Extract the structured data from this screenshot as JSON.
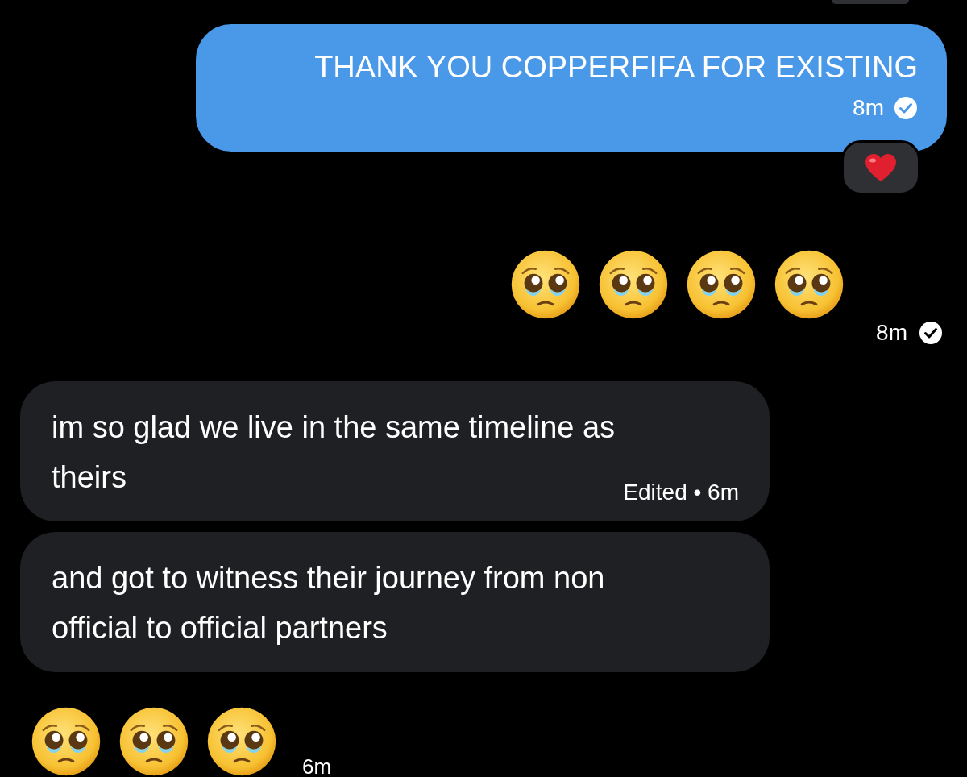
{
  "messages": [
    {
      "kind": "text",
      "outgoing": true,
      "text": "THANK YOU COPPERFIFA FOR EXISTING",
      "time": "8m",
      "read": true,
      "hearted": true
    },
    {
      "kind": "emoji",
      "outgoing": true,
      "emojis": [
        {
          "kind": "pleading"
        },
        {
          "kind": "pleading"
        },
        {
          "kind": "pleading"
        },
        {
          "kind": "pleading"
        }
      ],
      "time": "8m",
      "read": true
    },
    {
      "kind": "text",
      "outgoing": false,
      "text": "im so glad we live in the same timeline as theirs",
      "time": "Edited • 6m"
    },
    {
      "kind": "text",
      "outgoing": false,
      "text": "and got to witness their journey from non official to official partners"
    },
    {
      "kind": "emoji",
      "outgoing": false,
      "emojis": [
        {
          "kind": "pleading"
        },
        {
          "kind": "pleading"
        },
        {
          "kind": "pleading"
        }
      ],
      "time": "6m"
    }
  ]
}
